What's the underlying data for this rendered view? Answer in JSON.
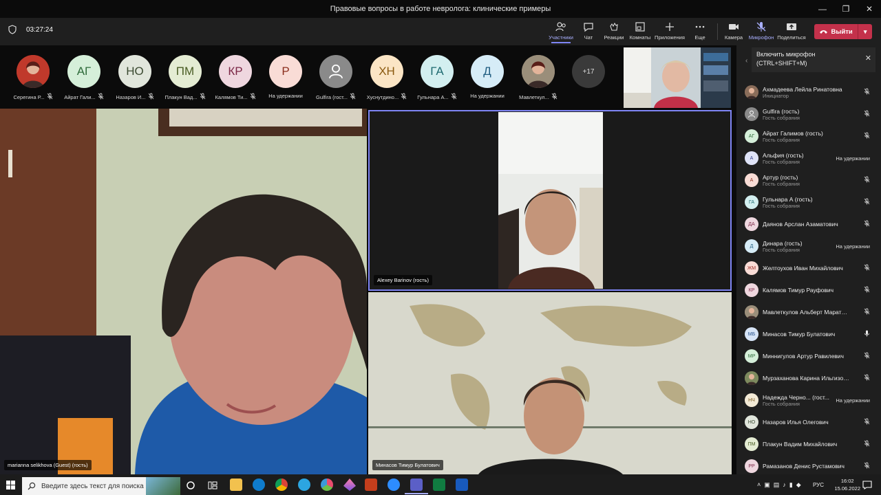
{
  "window": {
    "title": "Правовые вопросы в работе невролога: клинические примеры"
  },
  "toolbar": {
    "timer": "03:27:24",
    "buttons": {
      "participants": "Участники",
      "chat": "Чат",
      "reactions": "Реакции",
      "rooms": "Комнаты",
      "apps": "Приложения",
      "more": "Еще",
      "camera": "Камера",
      "mic": "Микрофон",
      "share": "Поделиться"
    },
    "leave": "Выйти"
  },
  "strip": [
    {
      "initials": "",
      "name": "Серегина Р...",
      "bg": "#c0392b",
      "fg": "#ffffff",
      "photo": true
    },
    {
      "initials": "АГ",
      "name": "Айрат Гали...",
      "bg": "#d5efd9",
      "fg": "#2e6b3a",
      "photo": false
    },
    {
      "initials": "НО",
      "name": "Назаров И...",
      "bg": "#e1e6dc",
      "fg": "#3b4a31",
      "photo": false
    },
    {
      "initials": "ПМ",
      "name": "Плакун Вад...",
      "bg": "#e4ecd3",
      "fg": "#4a5d24",
      "photo": false
    },
    {
      "initials": "КР",
      "name": "Калямов Ти...",
      "bg": "#efd7df",
      "fg": "#7b2746",
      "photo": false
    },
    {
      "initials": "Р",
      "name": "На удержании",
      "bg": "#f9dcd6",
      "fg": "#8c2f1e",
      "photo": false
    },
    {
      "initials": "",
      "name": "Gulfira (гост...",
      "bg": "#8a8a8a",
      "fg": "#ffffff",
      "photo": false
    },
    {
      "initials": "ХН",
      "name": "Хуснутдино...",
      "bg": "#fbe5c5",
      "fg": "#8a5a10",
      "photo": false
    },
    {
      "initials": "ГА",
      "name": "Гульнара А...",
      "bg": "#d3eff0",
      "fg": "#1e6a70",
      "photo": false
    },
    {
      "initials": "Д",
      "name": "На удержании",
      "bg": "#d6ecf7",
      "fg": "#1f5c80",
      "photo": false
    },
    {
      "initials": "",
      "name": "Мавлеткул...",
      "bg": "#9a8e7a",
      "fg": "#ffffff",
      "photo": true
    },
    {
      "initials": "+17",
      "name": "",
      "bg": "#3a3a3a",
      "fg": "#dddddd",
      "photo": false
    }
  ],
  "tiles": {
    "left_name": "marianna selikhova (Guest) (гость)",
    "top_right_name": "Alexey Barinov (гость)",
    "bottom_right_name": "Минасов Тимур Булатович"
  },
  "tooltip": {
    "line1": "Включить микрофон",
    "line2": "(CTRL+SHIFT+M)"
  },
  "participants": [
    {
      "initials": "",
      "name": "Ахмадеева Лейла Ринатовна",
      "sub": "Инициатор",
      "status": "",
      "bg": "#8a6d5a",
      "fg": "#fff",
      "photo": true,
      "mic": "off"
    },
    {
      "initials": "",
      "name": "Gulfira (гость)",
      "sub": "Гость собрания",
      "status": "",
      "bg": "#8a8a8a",
      "fg": "#fff",
      "photo": false,
      "mic": "off"
    },
    {
      "initials": "АГ",
      "name": "Айрат Галимов (гость)",
      "sub": "Гость собрания",
      "status": "",
      "bg": "#d5efd9",
      "fg": "#2e6b3a",
      "photo": false,
      "mic": "off"
    },
    {
      "initials": "А",
      "name": "Альфия (гость)",
      "sub": "Гость собрания",
      "status": "На удержании",
      "bg": "#dfe3f7",
      "fg": "#36408a",
      "photo": false,
      "mic": "none"
    },
    {
      "initials": "А",
      "name": "Артур (гость)",
      "sub": "Гость собрания",
      "status": "",
      "bg": "#f9dcd6",
      "fg": "#8c2f1e",
      "photo": false,
      "mic": "off"
    },
    {
      "initials": "ГА",
      "name": "Гульнара А (гость)",
      "sub": "Гость собрания",
      "status": "",
      "bg": "#d3eff0",
      "fg": "#1e6a70",
      "photo": false,
      "mic": "off"
    },
    {
      "initials": "ДА",
      "name": "Даянов Арслан Азаматович",
      "sub": "",
      "status": "",
      "bg": "#efd7df",
      "fg": "#7b2746",
      "photo": false,
      "mic": "off"
    },
    {
      "initials": "Д",
      "name": "Динара (гость)",
      "sub": "Гость собрания",
      "status": "На удержании",
      "bg": "#d6ecf7",
      "fg": "#1f5c80",
      "photo": false,
      "mic": "none"
    },
    {
      "initials": "ЖМ",
      "name": "Желтоухов Иван Михайлович",
      "sub": "",
      "status": "",
      "bg": "#f9dcd6",
      "fg": "#a0302a",
      "photo": false,
      "mic": "off"
    },
    {
      "initials": "КР",
      "name": "Калямов Тимур Рауфович",
      "sub": "",
      "status": "",
      "bg": "#efd7df",
      "fg": "#7b2746",
      "photo": false,
      "mic": "off"
    },
    {
      "initials": "",
      "name": "Мавлеткулов Альберт Марато...",
      "sub": "",
      "status": "",
      "bg": "#9a8e7a",
      "fg": "#fff",
      "photo": true,
      "mic": "off"
    },
    {
      "initials": "МБ",
      "name": "Минасов Тимур Булатович",
      "sub": "",
      "status": "",
      "bg": "#d6e4f7",
      "fg": "#24508c",
      "photo": false,
      "mic": "on"
    },
    {
      "initials": "МР",
      "name": "Миннигулов Артур Равилевич",
      "sub": "",
      "status": "",
      "bg": "#d5efd9",
      "fg": "#2e6b3a",
      "photo": false,
      "mic": "off"
    },
    {
      "initials": "",
      "name": "Мурзаханова Карина Ильгизов...",
      "sub": "",
      "status": "",
      "bg": "#7d8a5e",
      "fg": "#fff",
      "photo": true,
      "mic": "off"
    },
    {
      "initials": "НЧ",
      "name": "Надежда Черно... (гост...",
      "sub": "Гость собрания",
      "status": "На удержании",
      "bg": "#f3ead6",
      "fg": "#7a5a1e",
      "photo": false,
      "mic": "none"
    },
    {
      "initials": "НО",
      "name": "Назаров Илья Олегович",
      "sub": "",
      "status": "",
      "bg": "#e1e6dc",
      "fg": "#3b4a31",
      "photo": false,
      "mic": "off"
    },
    {
      "initials": "ПМ",
      "name": "Плакун Вадим Михайлович",
      "sub": "",
      "status": "",
      "bg": "#e4ecd3",
      "fg": "#4a5d24",
      "photo": false,
      "mic": "off"
    },
    {
      "initials": "РР",
      "name": "Рамазанов Денис Рустамович",
      "sub": "",
      "status": "",
      "bg": "#efd7df",
      "fg": "#7b2746",
      "photo": false,
      "mic": "off"
    }
  ],
  "taskbar": {
    "search_placeholder": "Введите здесь текст для поиска",
    "lang": "РУС",
    "time": "16:02",
    "date": "15.06.2022"
  }
}
